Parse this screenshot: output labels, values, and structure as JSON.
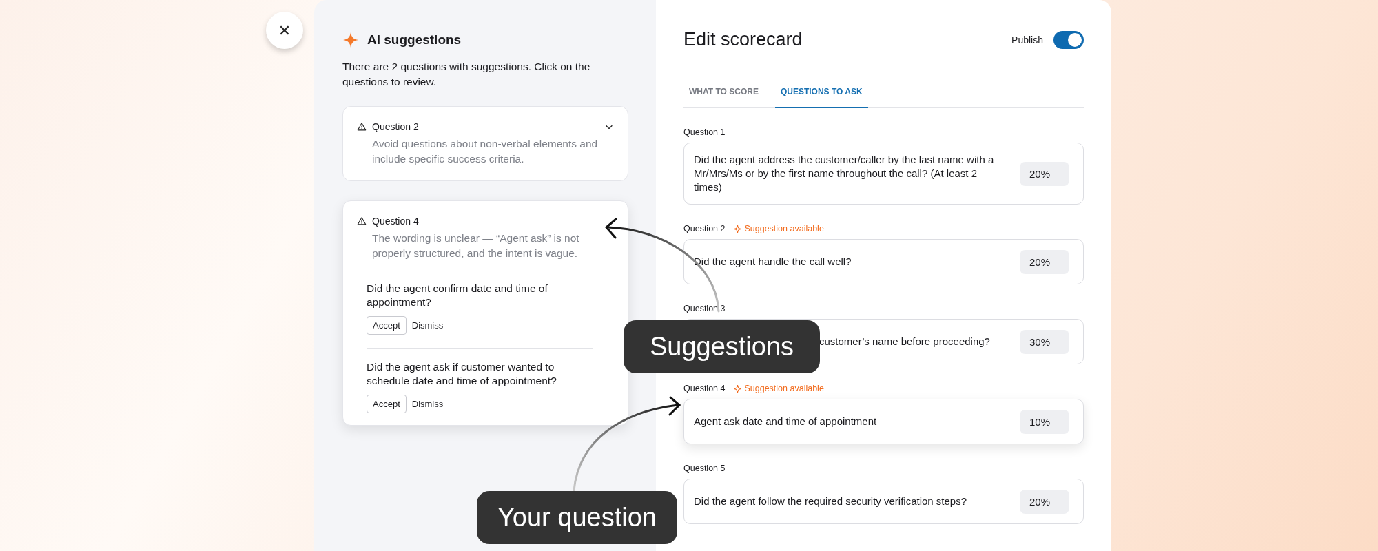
{
  "close_button": {
    "label": "✕"
  },
  "ai_panel": {
    "title": "AI suggestions",
    "description": "There are 2 questions with suggestions. Click on the questions to review.",
    "cards": [
      {
        "title": "Question 2",
        "message": "Avoid questions about non-verbal elements and include specific success criteria.",
        "expanded": false
      },
      {
        "title": "Question 4",
        "message": "The wording is unclear — “Agent ask” is not properly structured, and the intent is vague.",
        "expanded": true,
        "suggestions": [
          {
            "text": "Did the agent confirm date and time of appointment?",
            "accept": "Accept",
            "dismiss": "Dismiss"
          },
          {
            "text": "Did the agent ask if customer wanted to schedule date and time of appointment?",
            "accept": "Accept",
            "dismiss": "Dismiss"
          }
        ]
      }
    ]
  },
  "editor": {
    "title": "Edit scorecard",
    "publish": {
      "label": "Publish",
      "on": true
    },
    "tabs": [
      {
        "label": "WHAT TO SCORE",
        "selected": false
      },
      {
        "label": "QUESTIONS TO ASK",
        "selected": true
      }
    ],
    "questions": [
      {
        "label": "Question 1",
        "text": "Did the agent address the customer/caller by the last name with a Mr/Mrs/Ms or by the first name throughout the call? (At least 2 times)",
        "weight": "20%",
        "highlighted": false,
        "partly_hidden": false
      },
      {
        "label": "Question 2",
        "badge": "Suggestion available",
        "text": "Did the agent handle the call well?",
        "weight": "20%",
        "highlighted": false,
        "partly_hidden": false
      },
      {
        "label": "Question 3",
        "text": "customer’s name before proceeding?",
        "weight": "30%",
        "highlighted": false,
        "partly_hidden": true
      },
      {
        "label": "Question 4",
        "badge": "Suggestion available",
        "text": "Agent ask date and time of appointment",
        "weight": "10%",
        "highlighted": true,
        "partly_hidden": false
      },
      {
        "label": "Question 5",
        "text": "Did the agent follow the required security verification steps?",
        "weight": "20%",
        "highlighted": false,
        "partly_hidden": false
      }
    ]
  },
  "callouts": [
    {
      "text": "Suggestions",
      "kind": "suggestions"
    },
    {
      "text": "Your question",
      "kind": "question"
    }
  ]
}
